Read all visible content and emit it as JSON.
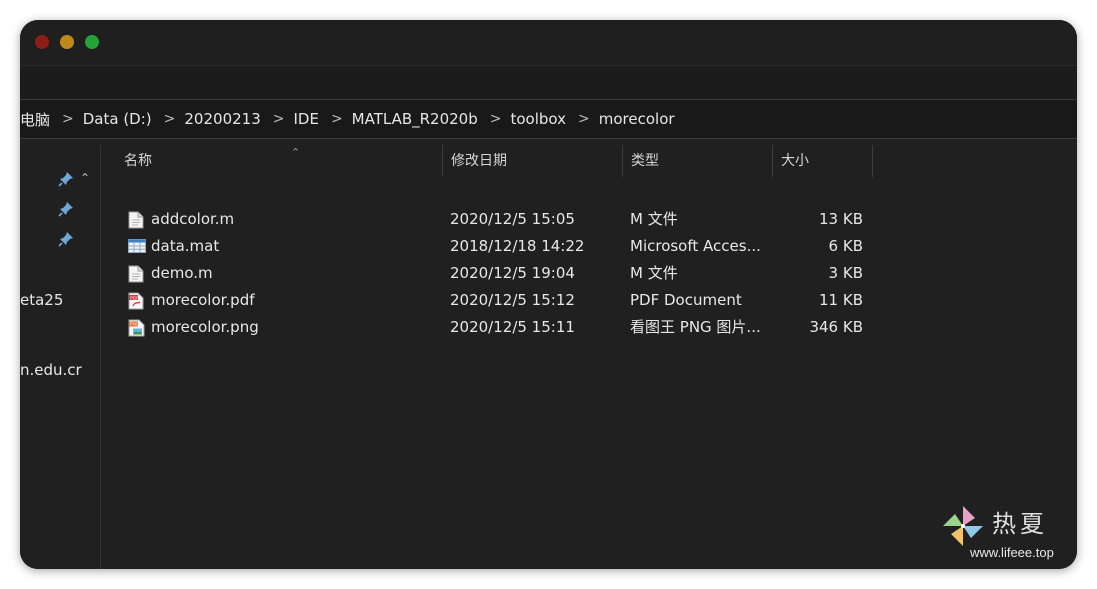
{
  "breadcrumb": {
    "items": [
      "电脑",
      "Data (D:)",
      "20200213",
      "IDE",
      "MATLAB_R2020b",
      "toolbox",
      "morecolor"
    ],
    "separator": ">"
  },
  "sidebar": {
    "items": [
      "eta25",
      "n.edu.cr"
    ]
  },
  "columns": {
    "name": "名称",
    "date": "修改日期",
    "type": "类型",
    "size": "大小"
  },
  "files": [
    {
      "name": "addcolor.m",
      "date": "2020/12/5 15:05",
      "type": "M 文件",
      "size": "13 KB",
      "icon": "m-file-icon"
    },
    {
      "name": "data.mat",
      "date": "2018/12/18 14:22",
      "type": "Microsoft Acces...",
      "size": "6 KB",
      "icon": "table-file-icon"
    },
    {
      "name": "demo.m",
      "date": "2020/12/5 19:04",
      "type": "M 文件",
      "size": "3 KB",
      "icon": "m-file-icon"
    },
    {
      "name": "morecolor.pdf",
      "date": "2020/12/5 15:12",
      "type": "PDF Document",
      "size": "11 KB",
      "icon": "pdf-file-icon"
    },
    {
      "name": "morecolor.png",
      "date": "2020/12/5 15:11",
      "type": "看图王 PNG 图片...",
      "size": "346 KB",
      "icon": "png-file-icon"
    }
  ],
  "watermark": {
    "text": "热夏",
    "url": "www.lifeee.top"
  },
  "colors": {
    "window_bg": "#202020",
    "close": "#8e1d17",
    "minimize": "#c08a1a",
    "maximize": "#23a338",
    "pin": "#6fa7d8"
  }
}
